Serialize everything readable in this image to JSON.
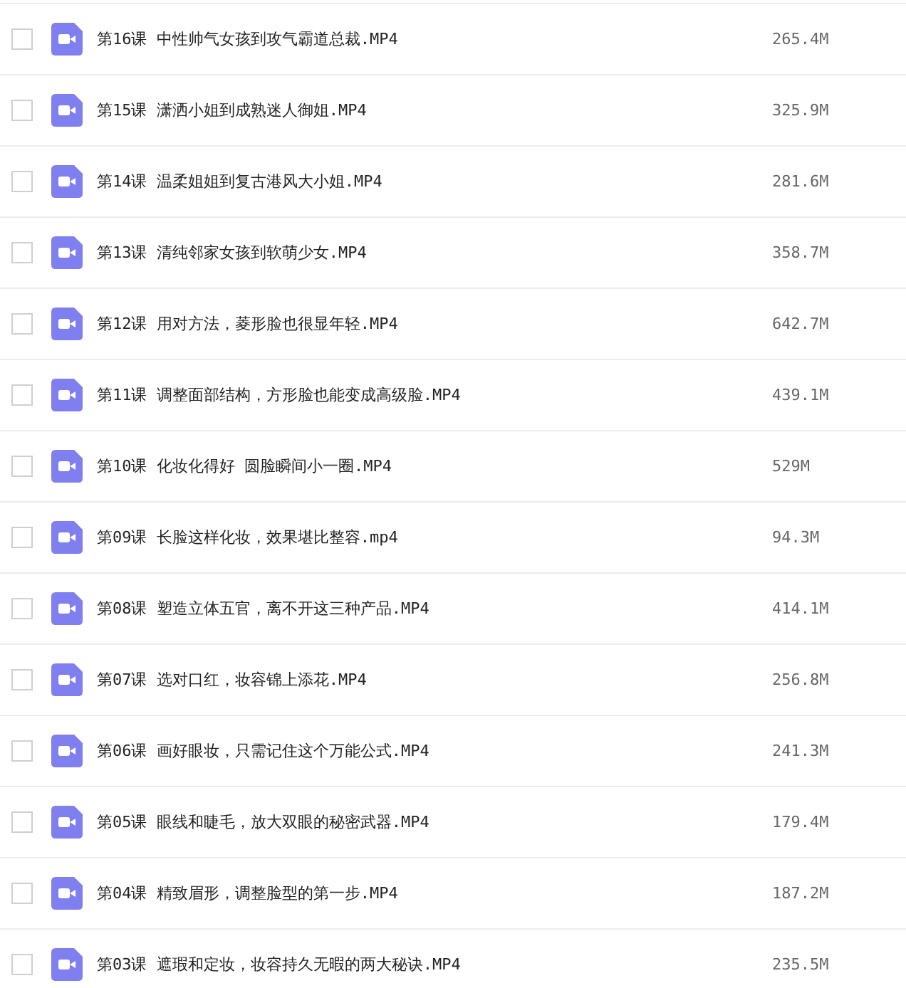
{
  "files": [
    {
      "name": "第16课 中性帅气女孩到攻气霸道总裁.MP4",
      "size": "265.4M",
      "checked": false
    },
    {
      "name": "第15课 潇洒小姐到成熟迷人御姐.MP4",
      "size": "325.9M",
      "checked": false
    },
    {
      "name": "第14课 温柔姐姐到复古港风大小姐.MP4",
      "size": "281.6M",
      "checked": false
    },
    {
      "name": "第13课 清纯邻家女孩到软萌少女.MP4",
      "size": "358.7M",
      "checked": false
    },
    {
      "name": "第12课 用对方法，菱形脸也很显年轻.MP4",
      "size": "642.7M",
      "checked": false
    },
    {
      "name": "第11课 调整面部结构，方形脸也能变成高级脸.MP4",
      "size": "439.1M",
      "checked": false
    },
    {
      "name": "第10课 化妆化得好 圆脸瞬间小一圈.MP4",
      "size": "529M",
      "checked": false
    },
    {
      "name": "第09课 长脸这样化妆，效果堪比整容.mp4",
      "size": "94.3M",
      "checked": false
    },
    {
      "name": "第08课 塑造立体五官，离不开这三种产品.MP4",
      "size": "414.1M",
      "checked": false
    },
    {
      "name": "第07课 选对口红，妆容锦上添花.MP4",
      "size": "256.8M",
      "checked": false
    },
    {
      "name": "第06课 画好眼妆，只需记住这个万能公式.MP4",
      "size": "241.3M",
      "checked": false
    },
    {
      "name": "第05课 眼线和睫毛，放大双眼的秘密武器.MP4",
      "size": "179.4M",
      "checked": false
    },
    {
      "name": "第04课 精致眉形，调整脸型的第一步.MP4",
      "size": "187.2M",
      "checked": false
    },
    {
      "name": "第03课 遮瑕和定妆，妆容持久无暇的两大秘诀.MP4",
      "size": "235.5M",
      "checked": false
    }
  ]
}
